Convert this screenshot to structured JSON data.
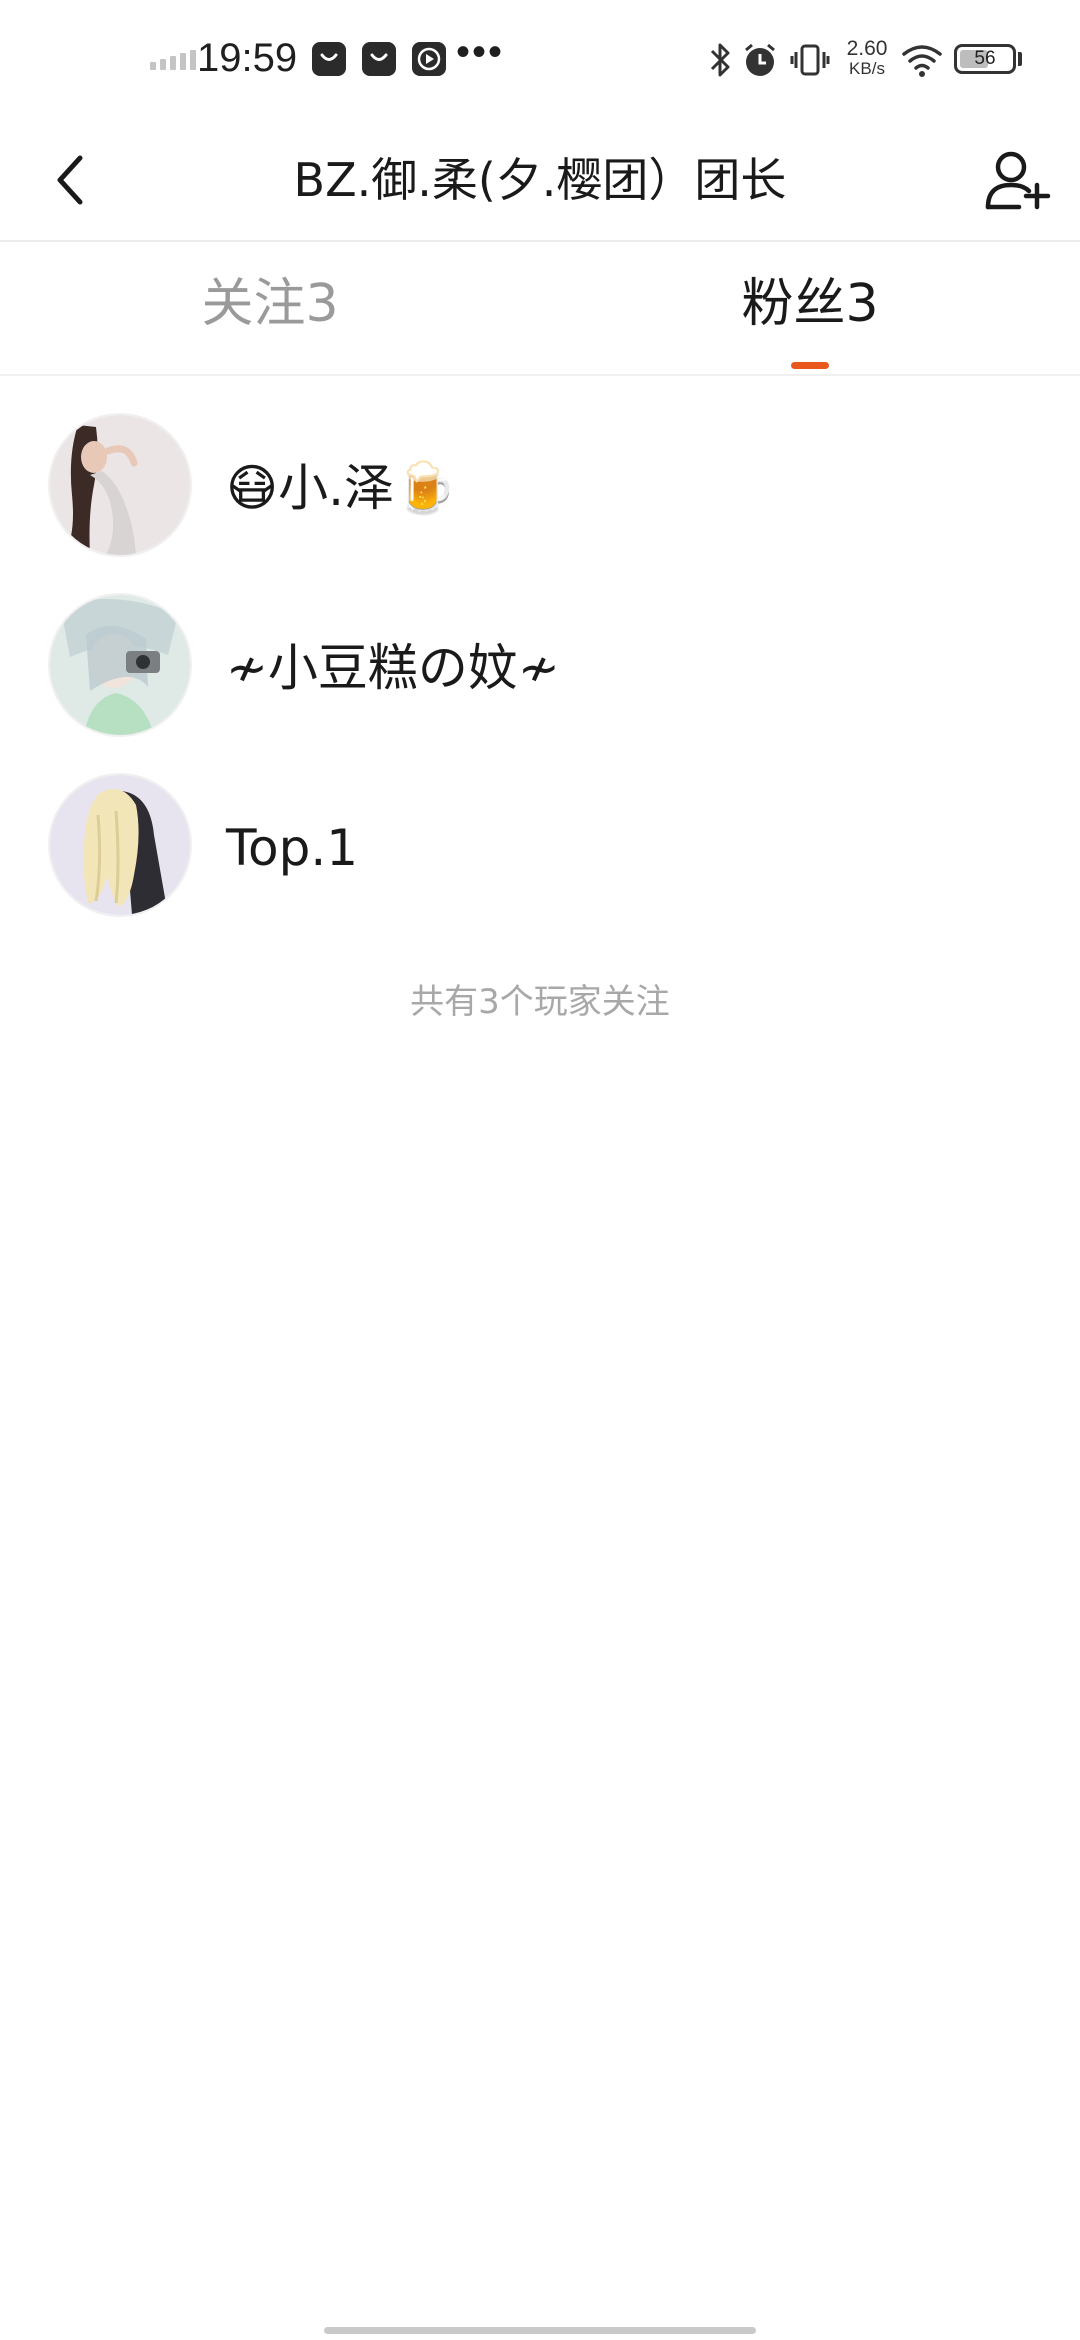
{
  "status_bar": {
    "time": "19:59",
    "more": "•••",
    "net_speed_value": "2.60",
    "net_speed_unit": "KB/s",
    "battery": "56",
    "battery_level": 0.56,
    "icons": [
      "signal-icon",
      "notification-bag-icon",
      "notification-bag-icon",
      "play-icon",
      "bluetooth-icon",
      "alarm-icon",
      "vibrate-icon",
      "wifi-icon",
      "battery-icon"
    ]
  },
  "header": {
    "title": "BZ.御.柔(夕.樱团）团长",
    "back_icon": "chevron-left-icon",
    "add_icon": "add-user-icon"
  },
  "tabs": [
    {
      "label": "关注3",
      "active": false
    },
    {
      "label": "粉丝3",
      "active": true
    }
  ],
  "accent_color": "#e8581c",
  "followers": [
    {
      "name": "😷小.泽🍺"
    },
    {
      "name": "≁小豆糕の妏≁"
    },
    {
      "name": "Top.1"
    }
  ],
  "footer_note": "共有3个玩家关注"
}
